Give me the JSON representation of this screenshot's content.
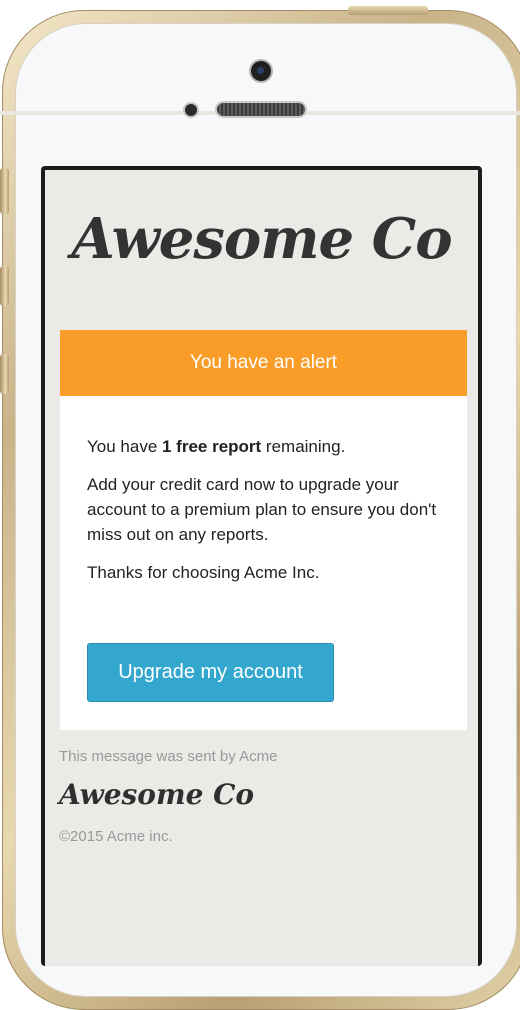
{
  "email": {
    "brand_logo": "Awesome Co",
    "alert": {
      "header": "You have an alert",
      "line1_prefix": "You have ",
      "line1_bold": "1 free report",
      "line1_suffix": " remaining.",
      "paragraph2": "Add your credit card now to upgrade your account to a premium plan to ensure you don't miss out on any reports.",
      "paragraph3": "Thanks for choosing Acme Inc.",
      "button_label": "Upgrade my account"
    },
    "footer": {
      "sent_by": "This message was sent by Acme",
      "logo": "Awesome Co",
      "copyright": "©2015 Acme inc."
    }
  },
  "colors": {
    "alert_header_bg": "#f99d28",
    "button_bg": "#33a7cd",
    "email_background": "#eceae7",
    "phone_frame": "#d9c79f"
  }
}
